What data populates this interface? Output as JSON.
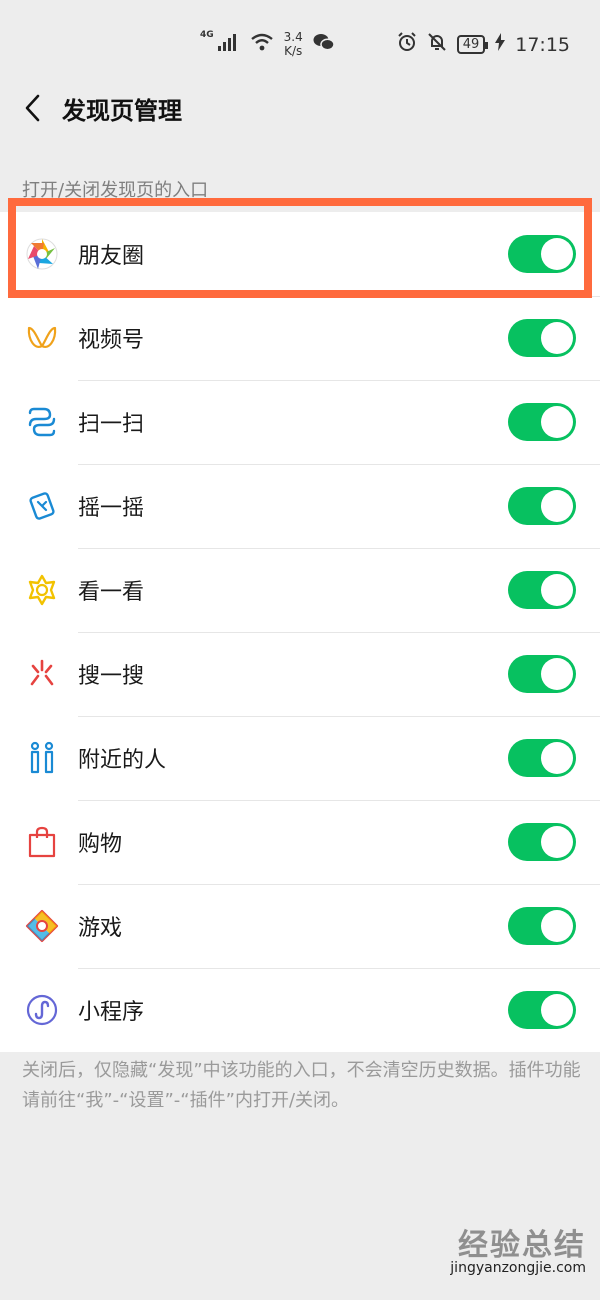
{
  "status_bar": {
    "signal_tag": "4G",
    "speed_value": "3.4",
    "speed_unit": "K/s",
    "battery": "49",
    "time": "17:15"
  },
  "header": {
    "title": "发现页管理"
  },
  "section": {
    "label": "打开/关闭发现页的入口"
  },
  "items": [
    {
      "label": "朋友圈",
      "enabled": true,
      "icon": "moments-icon"
    },
    {
      "label": "视频号",
      "enabled": true,
      "icon": "channels-icon"
    },
    {
      "label": "扫一扫",
      "enabled": true,
      "icon": "scan-icon"
    },
    {
      "label": "摇一摇",
      "enabled": true,
      "icon": "shake-icon"
    },
    {
      "label": "看一看",
      "enabled": true,
      "icon": "top-stories-icon"
    },
    {
      "label": "搜一搜",
      "enabled": true,
      "icon": "search-icon"
    },
    {
      "label": "附近的人",
      "enabled": true,
      "icon": "people-nearby-icon"
    },
    {
      "label": "购物",
      "enabled": true,
      "icon": "shopping-bag-icon"
    },
    {
      "label": "游戏",
      "enabled": true,
      "icon": "games-icon"
    },
    {
      "label": "小程序",
      "enabled": true,
      "icon": "mini-programs-icon"
    }
  ],
  "footer": {
    "note": "关闭后，仅隐藏“发现”中该功能的入口，不会清空历史数据。插件功能请前往“我”-“设置”-“插件”内打开/关闭。"
  },
  "watermark": {
    "brand": "经验总结",
    "url": "jingyanzongjie.com"
  },
  "colors": {
    "toggle_on": "#07c160",
    "highlight": "#ff6a3d",
    "background": "#ededed"
  }
}
